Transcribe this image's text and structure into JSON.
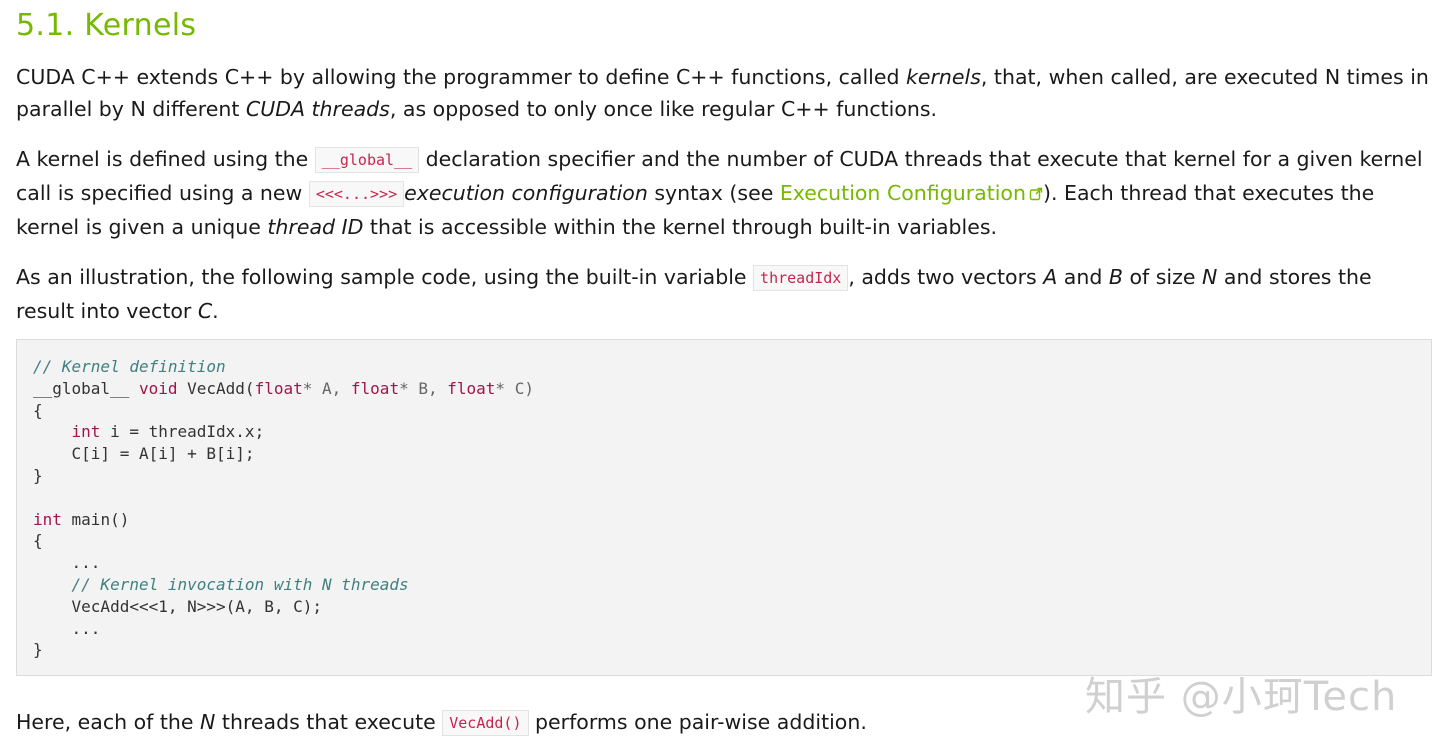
{
  "section": {
    "title": "5.1. Kernels"
  },
  "paragraph1": {
    "t1": "CUDA C++ extends C++ by allowing the programmer to define C++ functions, called ",
    "kernels": "kernels",
    "t2": ", that, when called, are executed N times in parallel by N different ",
    "cuda_threads": "CUDA threads",
    "t3": ", as opposed to only once like regular C++ functions."
  },
  "paragraph2": {
    "t1": "A kernel is defined using the ",
    "code_global": "__global__",
    "t2": " declaration specifier and the number of CUDA threads that execute that kernel for a given kernel call is specified using a new ",
    "code_launch": "<<<...>>>",
    "exec_config": "execution configuration",
    "t3": " syntax (see ",
    "link": "Execution Configuration",
    "t4": "). Each thread that executes the kernel is given a unique ",
    "thread_id": "thread ID",
    "t5": " that is accessible within the kernel through built-in variables."
  },
  "paragraph3": {
    "t1": "As an illustration, the following sample code, using the built-in variable ",
    "code_threadidx": "threadIdx",
    "t2": ", adds two vectors ",
    "a": "A",
    "t3": " and ",
    "b": "B",
    "t4": " of size ",
    "n": "N",
    "t5": " and stores the result into vector ",
    "c": "C",
    "t6": "."
  },
  "code": {
    "l1_comment": "// Kernel definition",
    "l2_global": "__global__ ",
    "l2_void": "void",
    "l2_a": " VecAdd(",
    "l2_float1": "float",
    "l2_b": "* A, ",
    "l2_float2": "float",
    "l2_c": "* B, ",
    "l2_float3": "float",
    "l2_d": "* C)",
    "l3": "{",
    "l4_indent": "    ",
    "l4_int": "int",
    "l4_rest": " i = threadIdx.x;",
    "l5": "    C[i] = A[i] + B[i];",
    "l6": "}",
    "l8_int": "int",
    "l8_rest": " main()",
    "l9": "{",
    "l10": "    ...",
    "l11_indent": "    ",
    "l11_comment": "// Kernel invocation with N threads",
    "l12": "    VecAdd<<<1, N>>>(A, B, C);",
    "l13": "    ...",
    "l14": "}"
  },
  "paragraph4": {
    "t1": "Here, each of the ",
    "n": "N",
    "t2": " threads that execute ",
    "code_vecadd": "VecAdd()",
    "t3": " performs one pair-wise addition."
  },
  "watermark": {
    "text": "知乎 @小珂Tech"
  },
  "colors": {
    "accent": "#76b900",
    "inline_code": "#c7254e",
    "code_bg": "#f3f3f3"
  },
  "icons": {
    "external_link": "external-link-icon"
  }
}
